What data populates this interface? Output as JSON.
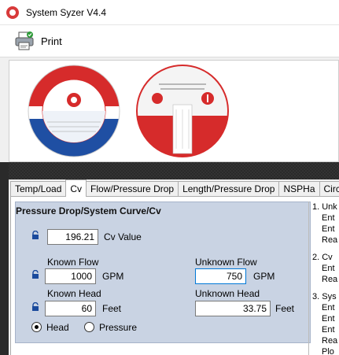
{
  "window": {
    "title": "System Syzer V4.4"
  },
  "toolbar": {
    "print_label": "Print"
  },
  "tabs": [
    {
      "label": "Temp/Load"
    },
    {
      "label": "Cv"
    },
    {
      "label": "Flow/Pressure Drop"
    },
    {
      "label": "Length/Pressure Drop"
    },
    {
      "label": "NSPHa"
    },
    {
      "label": "Circu"
    }
  ],
  "active_tab": "Cv",
  "panel": {
    "title": "Pressure Drop/System Curve/Cv",
    "cv_value": "196.21",
    "cv_label": "Cv Value",
    "known_flow_label": "Known Flow",
    "known_flow_value": "1000",
    "known_flow_unit": "GPM",
    "unknown_flow_label": "Unknown Flow",
    "unknown_flow_value": "750",
    "unknown_flow_unit": "GPM",
    "known_head_label": "Known Head",
    "known_head_value": "60",
    "known_head_unit": "Feet",
    "unknown_head_label": "Unknown Head",
    "unknown_head_value": "33.75",
    "unknown_head_unit": "Feet",
    "radio_head_label": "Head",
    "radio_pressure_label": "Pressure",
    "selected_radio": "Head"
  },
  "notes": {
    "n1": "1. Unk",
    "n1a": "Ent",
    "n1b": "Ent",
    "n1c": "Rea",
    "n2": "2. Cv",
    "n2a": "Ent",
    "n2b": "Rea",
    "n3": "3. Sys",
    "n3a": "Ent",
    "n3b": "Ent",
    "n3c": "Ent",
    "n3d": "Rea",
    "n3e": "Plo"
  },
  "colors": {
    "accent_red": "#d62b2b",
    "accent_blue": "#1f4fa3",
    "panel_bg": "#c9d3e3"
  }
}
